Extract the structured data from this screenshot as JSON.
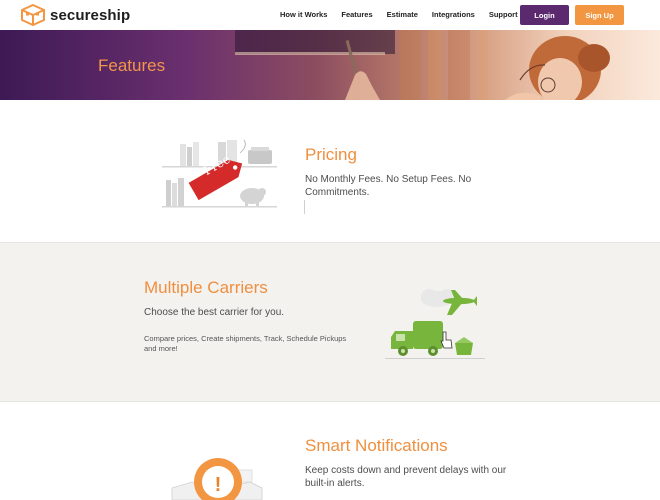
{
  "header": {
    "logo_text": "secureship",
    "nav": [
      "How it Works",
      "Features",
      "Estimate",
      "Integrations",
      "Support"
    ],
    "login_label": "Login",
    "signup_label": "Sign Up"
  },
  "hero": {
    "title": "Features"
  },
  "features": {
    "pricing": {
      "title": "Pricing",
      "desc": "No Monthly Fees. No Setup Fees. No Commitments.",
      "tag_label": "Free"
    },
    "carriers": {
      "title": "Multiple Carriers",
      "desc": "Choose the best carrier for you.",
      "note": "Compare prices, Create shipments, Track, Schedule Pickups and more!"
    },
    "notifications": {
      "title": "Smart Notifications",
      "desc": "Keep costs down and prevent delays with our built-in alerts.",
      "alert_symbol": "!"
    }
  },
  "colors": {
    "accent_orange": "#ef8f3f",
    "login_purple": "#5b2a6e",
    "truck_green": "#78b53c",
    "tag_red": "#d42a2a"
  }
}
